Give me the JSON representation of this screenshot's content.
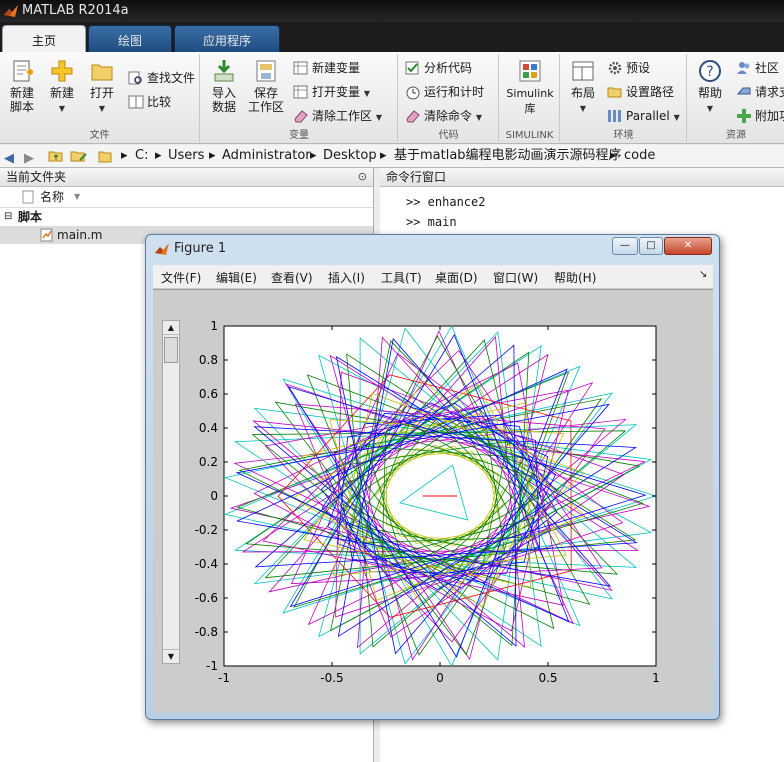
{
  "app": {
    "title": "MATLAB R2014a"
  },
  "tabs": [
    {
      "label": "主页"
    },
    {
      "label": "绘图"
    },
    {
      "label": "应用程序"
    }
  ],
  "ribbon": {
    "file": {
      "label": "文件",
      "new_script": "新建\n脚本",
      "new": "新建",
      "open": "打开",
      "find_files": "查找文件",
      "compare": "比较"
    },
    "variable": {
      "label": "变量",
      "import_data": "导入\n数据",
      "save_workspace": "保存\n工作区",
      "new_variable": "新建变量",
      "open_variable": "打开变量",
      "clear_workspace": "清除工作区"
    },
    "code": {
      "label": "代码",
      "analyze_code": "分析代码",
      "run_and_time": "运行和计时",
      "clear_commands": "清除命令"
    },
    "simulink": {
      "label": "SIMULINK",
      "button": "Simulink\n库"
    },
    "environment": {
      "label": "环境",
      "layout": "布局",
      "preferences": "预设",
      "set_path": "设置路径",
      "parallel": "Parallel"
    },
    "resources": {
      "label": "资源",
      "help": "帮助",
      "community": "社区",
      "request_support": "请求支",
      "addons": "附加功"
    }
  },
  "address": {
    "segments": [
      "C:",
      "Users",
      "Administrator",
      "Desktop",
      "基于matlab编程电影动画演示源码程序",
      "code"
    ]
  },
  "current_folder": {
    "title": "当前文件夹",
    "column_name": "名称",
    "group": "脚本",
    "files": [
      "main.m"
    ]
  },
  "command_window": {
    "title": "命令行窗口",
    "lines": [
      ">> enhance2",
      ">> main"
    ]
  },
  "figure": {
    "title": "Figure 1",
    "menus": [
      "文件(F)",
      "编辑(E)",
      "查看(V)",
      "插入(I)",
      "工具(T)",
      "桌面(D)",
      "窗口(W)",
      "帮助(H)"
    ],
    "minimize": "—",
    "maximize": "□",
    "close": "✕"
  },
  "chart_data": {
    "type": "line",
    "title": "",
    "xlabel": "",
    "ylabel": "",
    "xlim": [
      -1,
      1
    ],
    "ylim": [
      -1,
      1
    ],
    "xticks": [
      "-1",
      "-0.5",
      "0",
      "0.5",
      "1"
    ],
    "yticks": [
      "1",
      "0.8",
      "0.6",
      "0.4",
      "0.2",
      "0",
      "-0.2",
      "-0.4",
      "-0.6",
      "-0.8",
      "-1"
    ],
    "grid": false,
    "pattern": "concentric star polygons (chords) colored cyclically, unit-circle outer boundary",
    "series": [
      {
        "color": "#00c0c0",
        "radius": 1.0,
        "points": 29,
        "step": 11
      },
      {
        "color": "#c000c0",
        "radius": 0.97,
        "points": 23,
        "step": 9
      },
      {
        "color": "#008000",
        "radius": 0.94,
        "points": 27,
        "step": 10
      },
      {
        "color": "#ff0000",
        "radius": 0.75,
        "points": 25,
        "step": 5
      },
      {
        "color": "#0000ff",
        "radius": 0.55,
        "points": 31,
        "step": 6
      },
      {
        "color": "#c0c000",
        "radius": 0.3,
        "points": 21,
        "step": 4
      },
      {
        "color": "#00c0c0",
        "radius": 0.19,
        "points": 27,
        "step": 9
      },
      {
        "color": "#c000c0",
        "radius": 0.86,
        "points": 19,
        "step": 6
      },
      {
        "color": "#c0c000",
        "radius": 0.68,
        "points": 17,
        "step": 5
      },
      {
        "color": "#008000",
        "radius": 0.45,
        "points": 23,
        "step": 7
      },
      {
        "color": "#0000ff",
        "radius": 0.95,
        "points": 21,
        "step": 8
      }
    ],
    "center_line": {
      "color": "#ff0000",
      "x": [
        -0.08,
        0.08
      ],
      "y": [
        0,
        0
      ]
    }
  }
}
